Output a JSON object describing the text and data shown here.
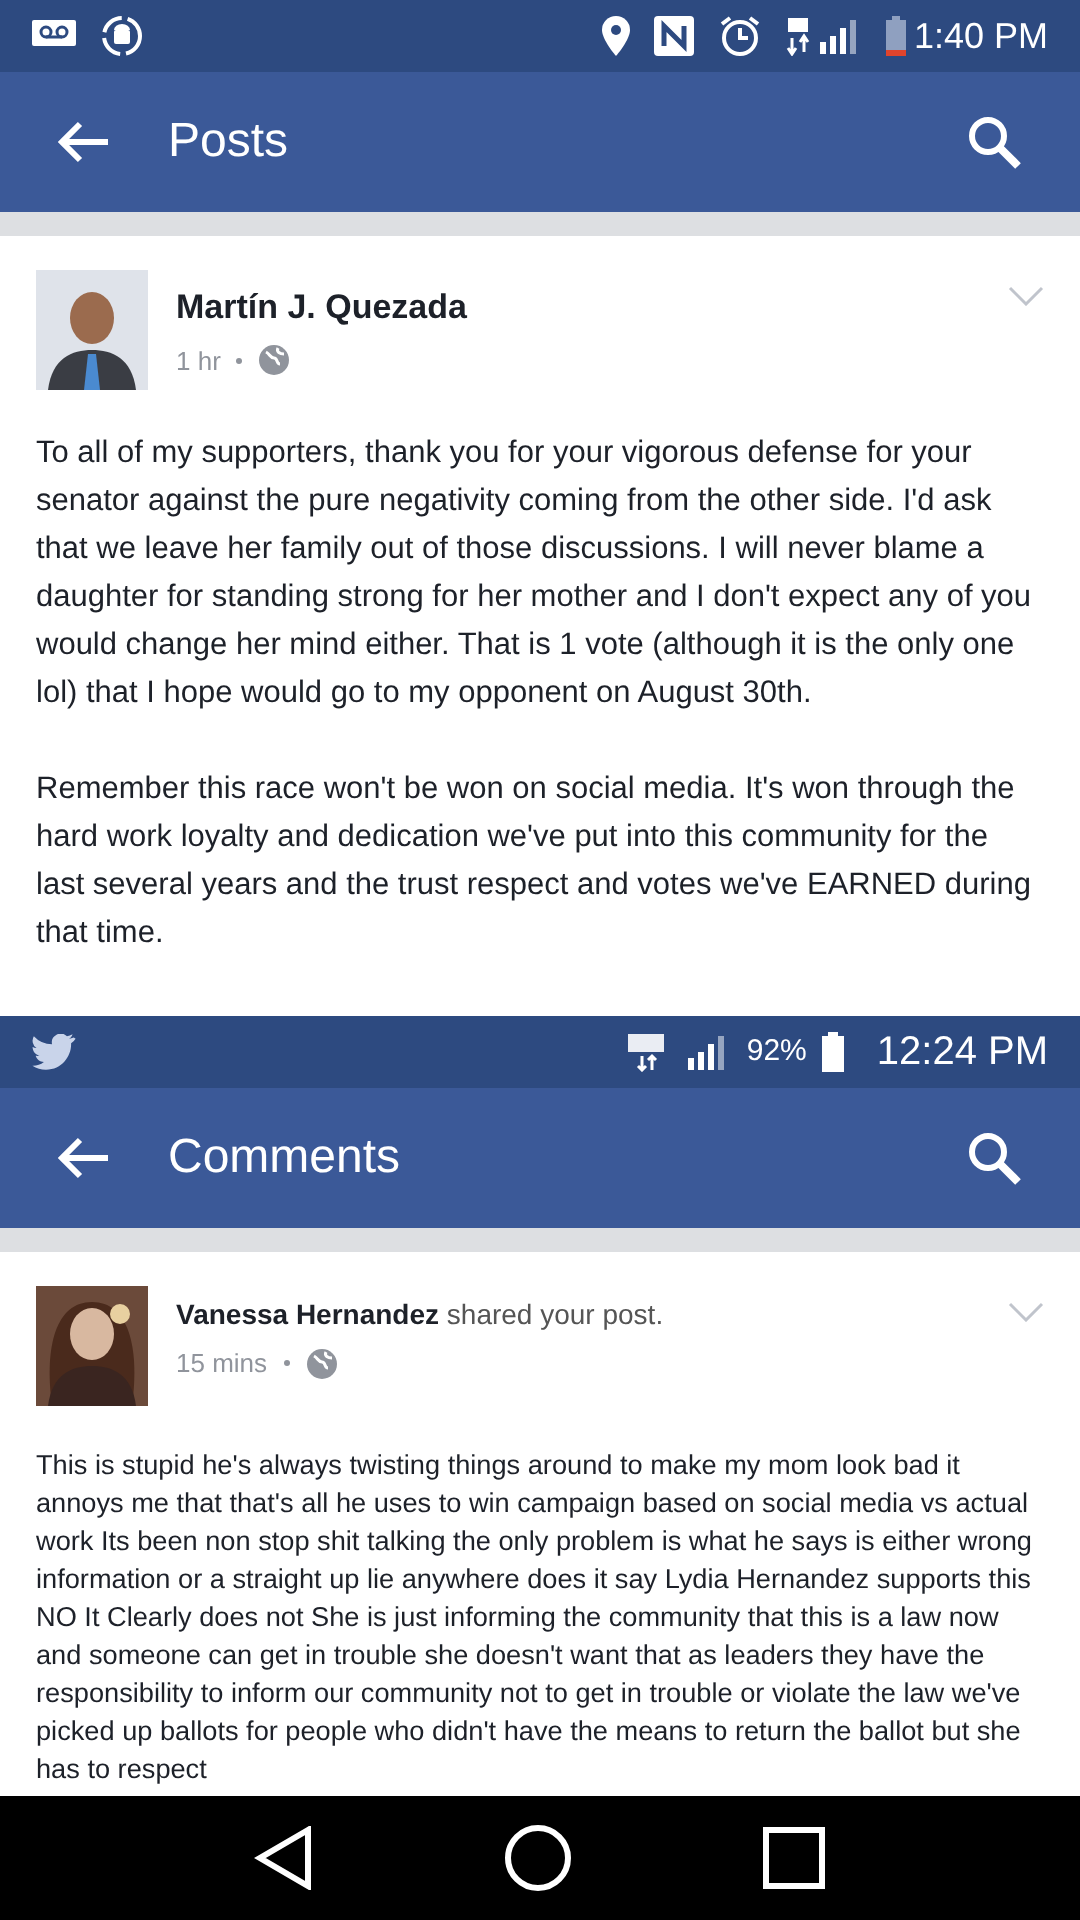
{
  "screens": [
    {
      "status_bar": {
        "time": "1:40 PM",
        "kind": "first"
      },
      "app_bar": {
        "title": "Posts"
      },
      "post": {
        "author": "Martín J. Quezada",
        "time": "1 hr",
        "paragraphs": [
          "To all of my supporters, thank you for your vigorous defense for your senator against the pure negativity coming from the other side. I'd ask that we leave her family out of those discussions. I will never blame a daughter for standing strong for her mother and I don't expect any of you would change her mind either. That is 1 vote (although it is the only one lol)  that I hope would go to my opponent on August 30th.",
          "Remember this race won't be won on social media. It's won through the hard work loyalty and dedication we've put into this community for the last several years and the trust respect and votes we've EARNED during that time."
        ]
      }
    },
    {
      "status_bar": {
        "time": "12:24 PM",
        "battery": "92%",
        "kind": "second"
      },
      "app_bar": {
        "title": "Comments"
      },
      "post": {
        "author": "Vanessa Hernandez",
        "action": "shared your post.",
        "time": "15 mins",
        "paragraphs": [
          "This is stupid he's always twisting things around to make my mom look bad it annoys me that that's all he uses to win campaign based on social media vs actual work Its been non stop shit talking the only problem is what he says is either wrong information or a straight up lie anywhere does it say Lydia Hernandez supports this NO It Clearly does not She is just informing the community that this  is a law now and someone can get in trouble she doesn't want that as leaders they have the responsibility to inform our community not to get in trouble or violate the law we've picked up ballots for people who didn't have the means to return the ballot but she has to respect"
        ]
      }
    }
  ]
}
